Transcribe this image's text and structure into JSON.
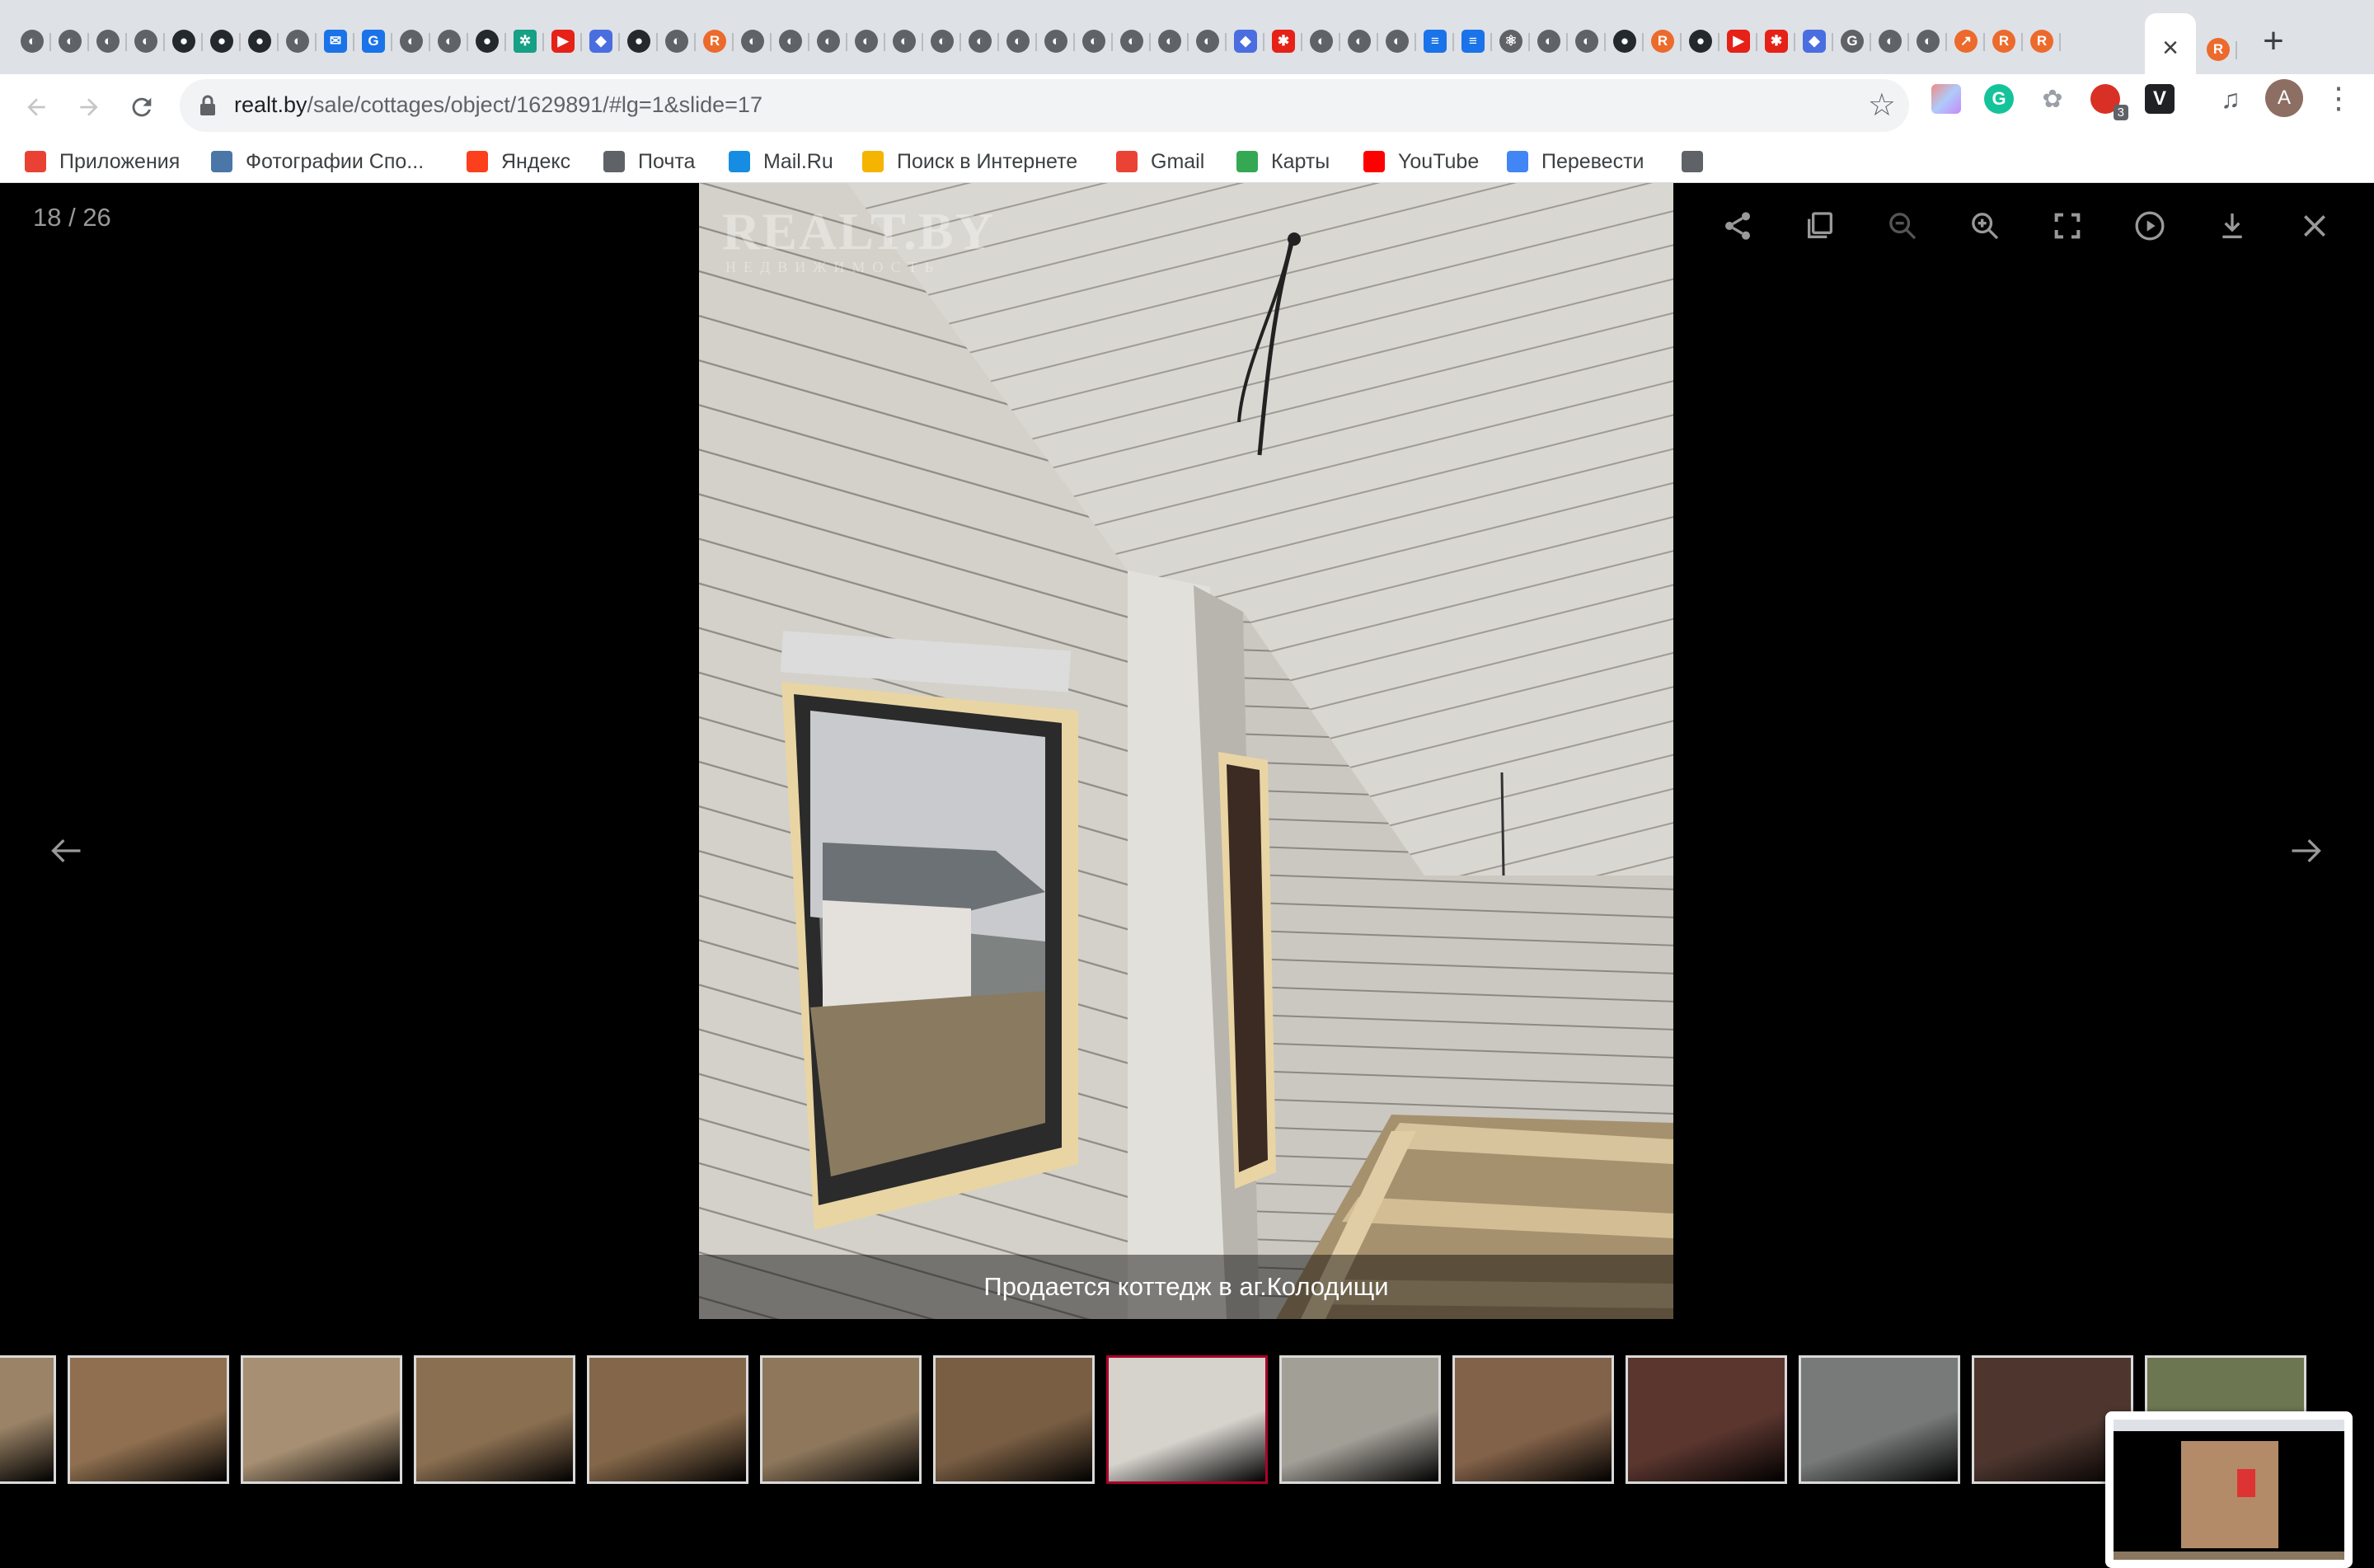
{
  "browser": {
    "url_host": "realt.by",
    "url_path": "/sale/cottages/object/1629891/#lg=1&slide=17",
    "tabs": [
      {
        "icon": "globe"
      },
      {
        "icon": "globe"
      },
      {
        "icon": "globe"
      },
      {
        "icon": "globe"
      },
      {
        "icon": "github"
      },
      {
        "icon": "github"
      },
      {
        "icon": "github"
      },
      {
        "icon": "globe"
      },
      {
        "icon": "blue"
      },
      {
        "icon": "translate"
      },
      {
        "icon": "globe"
      },
      {
        "icon": "globe"
      },
      {
        "icon": "github"
      },
      {
        "icon": "teal"
      },
      {
        "icon": "youtube"
      },
      {
        "icon": "purple"
      },
      {
        "icon": "github"
      },
      {
        "icon": "globe"
      },
      {
        "icon": "realt"
      },
      {
        "icon": "globe"
      },
      {
        "icon": "globe"
      },
      {
        "icon": "globe"
      },
      {
        "icon": "globe"
      },
      {
        "icon": "globe"
      },
      {
        "icon": "globe"
      },
      {
        "icon": "globe"
      },
      {
        "icon": "globe"
      },
      {
        "icon": "globe"
      },
      {
        "icon": "globe"
      },
      {
        "icon": "globe"
      },
      {
        "icon": "globe"
      },
      {
        "icon": "globe"
      },
      {
        "icon": "purple"
      },
      {
        "icon": "red"
      },
      {
        "icon": "globe"
      },
      {
        "icon": "globe"
      },
      {
        "icon": "globe"
      },
      {
        "icon": "docs"
      },
      {
        "icon": "docs"
      },
      {
        "icon": "react"
      },
      {
        "icon": "globe"
      },
      {
        "icon": "globe"
      },
      {
        "icon": "github"
      },
      {
        "icon": "realt"
      },
      {
        "icon": "github"
      },
      {
        "icon": "youtube"
      },
      {
        "icon": "red"
      },
      {
        "icon": "purple"
      },
      {
        "icon": "google"
      },
      {
        "icon": "globe"
      },
      {
        "icon": "globe"
      },
      {
        "icon": "orange"
      },
      {
        "icon": "realt"
      },
      {
        "icon": "realt"
      }
    ],
    "bookmarks": [
      {
        "label": "Приложения",
        "icon": "apps-icon",
        "color": "#e94235"
      },
      {
        "label": "Фотографии Спо...",
        "icon": "vk-icon",
        "color": "#4a76a8"
      },
      {
        "label": "Яндекс",
        "icon": "yandex-icon",
        "color": "#fc3f1d"
      },
      {
        "label": "Почта",
        "icon": "globe-icon",
        "color": "#5f6368"
      },
      {
        "label": "Mail.Ru",
        "icon": "mailru-icon",
        "color": "#168de2"
      },
      {
        "label": "Поиск в Интернете",
        "icon": "search-web-icon",
        "color": "#f4b400"
      },
      {
        "label": "Gmail",
        "icon": "gmail-icon",
        "color": "#ea4335"
      },
      {
        "label": "Карты",
        "icon": "maps-icon",
        "color": "#34a853"
      },
      {
        "label": "YouTube",
        "icon": "youtube-icon",
        "color": "#ff0000"
      },
      {
        "label": "Перевести",
        "icon": "translate-icon",
        "color": "#4285f4"
      },
      {
        "label": "",
        "icon": "globe-icon",
        "color": "#5f6368"
      }
    ],
    "avatar_letter": "A",
    "extension_badge": "3"
  },
  "gallery": {
    "counter": "18 / 26",
    "caption": "Продается коттедж в аг.Колодищи",
    "watermark_title": "REALT.BY",
    "watermark_sub": "НЕДВИЖИМОСТЬ",
    "active_index": 7,
    "thumbnails": [
      {
        "tone": "#b79b7a"
      },
      {
        "tone": "#a8835e"
      },
      {
        "tone": "#c4a886"
      },
      {
        "tone": "#a48360"
      },
      {
        "tone": "#9c7a57"
      },
      {
        "tone": "#a78c6c"
      },
      {
        "tone": "#8f6f50"
      },
      {
        "tone": "#d6d3cd"
      },
      {
        "tone": "#bfbbb2"
      },
      {
        "tone": "#9b7457"
      },
      {
        "tone": "#6b4038"
      },
      {
        "tone": "#8d8f8f"
      },
      {
        "tone": "#5c4038"
      },
      {
        "tone": "#7f8b5e"
      }
    ]
  },
  "colors": {
    "active_thumb_border": "#a90329",
    "accent": "#1a73e8"
  }
}
